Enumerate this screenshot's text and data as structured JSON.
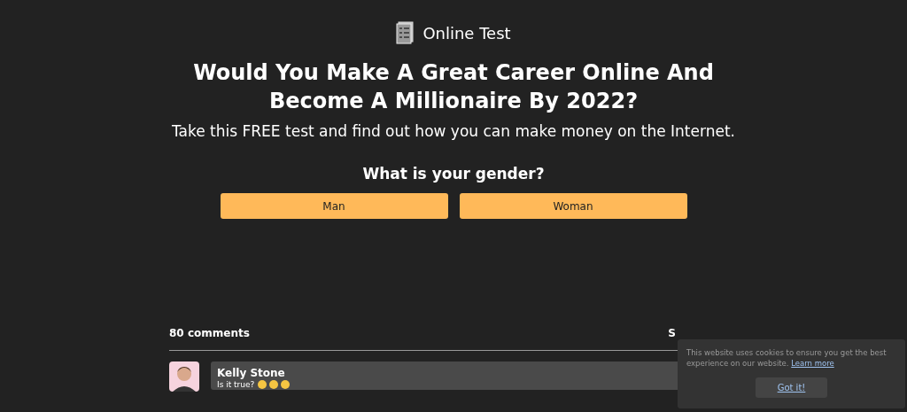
{
  "header": {
    "title": "Online Test"
  },
  "headline": "Would You Make A Great Career Online And Become A Millionaire By 2022?",
  "subtitle": "Take this FREE test and find out how you can make money on the Internet.",
  "question": {
    "text": "What is your gender?",
    "options": [
      "Man",
      "Woman"
    ]
  },
  "comments": {
    "count": "80 comments",
    "sort": "S",
    "items": [
      {
        "author": "Kelly Stone",
        "text": "Is it true?"
      }
    ]
  },
  "cookie_banner": {
    "text": "This website uses cookies to ensure you get the best experience on our website.",
    "link": "Learn more",
    "button": "Got it!"
  }
}
